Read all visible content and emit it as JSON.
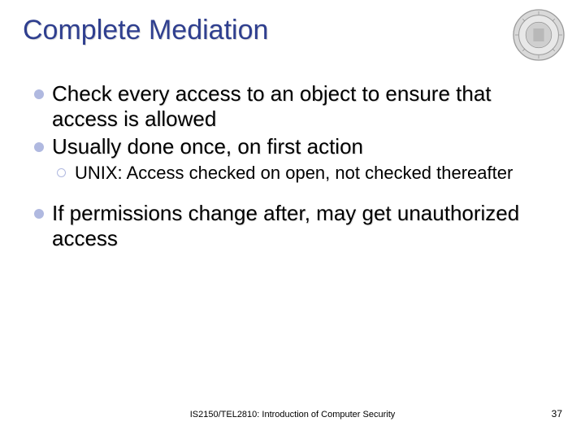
{
  "title": "Complete Mediation",
  "bullets": {
    "b1a": "Check every access to an object to ensure that access is allowed",
    "b1b": "Usually done once, on first action",
    "b2a": "UNIX: Access checked on open, not checked thereafter",
    "b1c": "If permissions change after, may get unauthorized access"
  },
  "footer": {
    "course": "IS2150/TEL2810: Introduction of Computer Security",
    "page": "37"
  }
}
